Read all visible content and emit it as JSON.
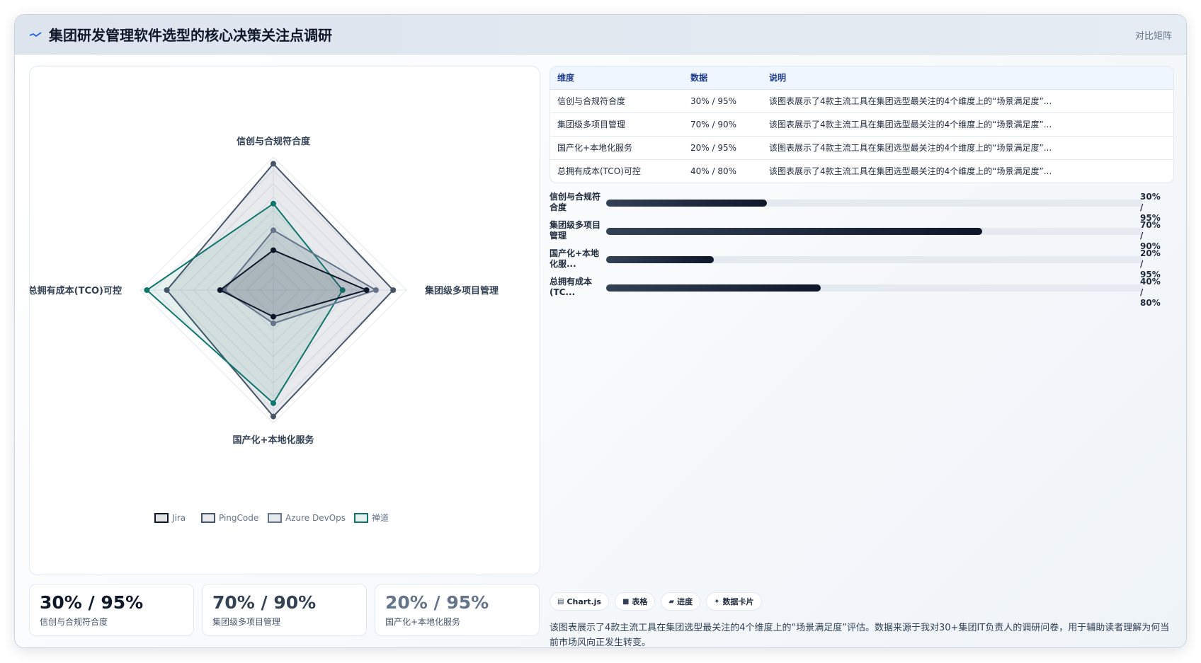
{
  "header": {
    "title": "集团研发管理软件选型的核心决策关注点调研",
    "mode": "对比矩阵",
    "logo_icon": "chart-line-icon"
  },
  "chart_data": {
    "type": "radar",
    "axes": [
      "信创与合规符合度",
      "集团级多项目管理",
      "国产化+本地化服务",
      "总拥有成本(TCO)可控"
    ],
    "range": [
      0,
      100
    ],
    "grid": true,
    "legend_position": "bottom",
    "series": [
      {
        "name": "Jira",
        "values": [
          30,
          70,
          20,
          40
        ],
        "color": "#0f172a"
      },
      {
        "name": "PingCode",
        "values": [
          95,
          90,
          95,
          80
        ],
        "color": "#475569"
      },
      {
        "name": "Azure DevOps",
        "values": [
          45,
          77,
          25,
          37
        ],
        "color": "#64748b"
      },
      {
        "name": "禅道",
        "values": [
          65,
          52,
          85,
          95
        ],
        "color": "#0f766e"
      }
    ]
  },
  "table": {
    "headers": [
      "维度",
      "数据",
      "说明"
    ],
    "rows": [
      [
        "信创与合规符合度",
        "30% / 95%",
        "该图表展示了4款主流工具在集团选型最关注的4个维度上的“场景满足度”..."
      ],
      [
        "集团级多项目管理",
        "70% / 90%",
        "该图表展示了4款主流工具在集团选型最关注的4个维度上的“场景满足度”..."
      ],
      [
        "国产化+本地化服务",
        "20% / 95%",
        "该图表展示了4款主流工具在集团选型最关注的4个维度上的“场景满足度”..."
      ],
      [
        "总拥有成本(TCO)可控",
        "40% / 80%",
        "该图表展示了4款主流工具在集团选型最关注的4个维度上的“场景满足度”..."
      ]
    ]
  },
  "progress": [
    {
      "label": "信创与合规符合度",
      "value": "30% / 95%",
      "percent": 30
    },
    {
      "label": "集团级多项目管理",
      "value": "70% / 90%",
      "percent": 70
    },
    {
      "label": "国产化+本地化服...",
      "value": "20% / 95%",
      "percent": 20
    },
    {
      "label": "总拥有成本(TC...",
      "value": "40% / 80%",
      "percent": 40
    }
  ],
  "kpis": [
    {
      "value": "30% / 95%",
      "label": "信创与合规符合度",
      "color": "#0f172a"
    },
    {
      "value": "70% / 90%",
      "label": "集团级多项目管理",
      "color": "#334155"
    },
    {
      "value": "20% / 95%",
      "label": "国产化+本地化服务",
      "color": "#64748b"
    }
  ],
  "chips": [
    {
      "label": "Chart.js",
      "icon": "chart-icon",
      "glyph": "▤"
    },
    {
      "label": "表格",
      "icon": "table-icon",
      "glyph": "■"
    },
    {
      "label": "进度",
      "icon": "progress-icon",
      "glyph": "▰"
    },
    {
      "label": "数据卡片",
      "icon": "sparkle-icon",
      "glyph": "✦"
    }
  ],
  "description": "该图表展示了4款主流工具在集团选型最关注的4个维度上的“场景满足度”评估。数据来源于我对30+集团IT负责人的调研问卷，用于辅助读者理解为何当前市场风向正发生转变。"
}
